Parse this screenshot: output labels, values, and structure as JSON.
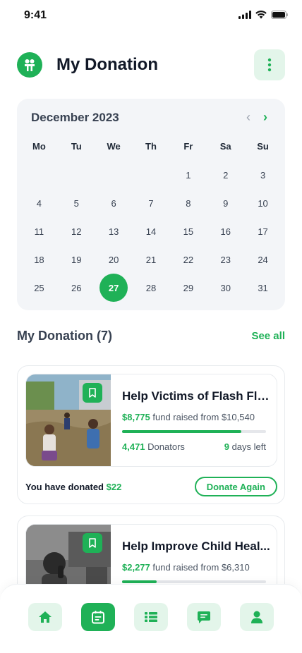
{
  "status_bar": {
    "time": "9:41"
  },
  "header": {
    "title": "My Donation"
  },
  "calendar": {
    "month": "December 2023",
    "weekdays": [
      "Mo",
      "Tu",
      "We",
      "Th",
      "Fr",
      "Sa",
      "Su"
    ],
    "days": [
      "1",
      "2",
      "3",
      "4",
      "5",
      "6",
      "7",
      "8",
      "9",
      "10",
      "11",
      "12",
      "13",
      "14",
      "15",
      "16",
      "17",
      "18",
      "19",
      "20",
      "21",
      "22",
      "23",
      "24",
      "25",
      "26",
      "27",
      "28",
      "29",
      "30",
      "31"
    ],
    "selected_day": "27"
  },
  "section": {
    "title": "My Donation (7)",
    "see_all": "See all"
  },
  "donations": [
    {
      "title": "Help Victims of Flash Flo...",
      "raised": "$8,775",
      "raised_text": "fund raised from",
      "goal": "$10,540",
      "progress": 0.83,
      "donators_count": "4,471",
      "donators_label": "Donators",
      "days_count": "9",
      "days_label": "days left",
      "donated_label": "You have donated",
      "donated_amount": "$22",
      "button": "Donate Again"
    },
    {
      "title": "Help Improve Child Heal...",
      "raised": "$2,277",
      "raised_text": "fund raised from",
      "goal": "$6,310",
      "progress": 0.24
    }
  ],
  "nav": [
    "home-icon",
    "calendar-icon",
    "list-icon",
    "chat-icon",
    "profile-icon"
  ],
  "colors": {
    "accent": "#1fb157",
    "accent_soft": "#e3f5ea"
  }
}
